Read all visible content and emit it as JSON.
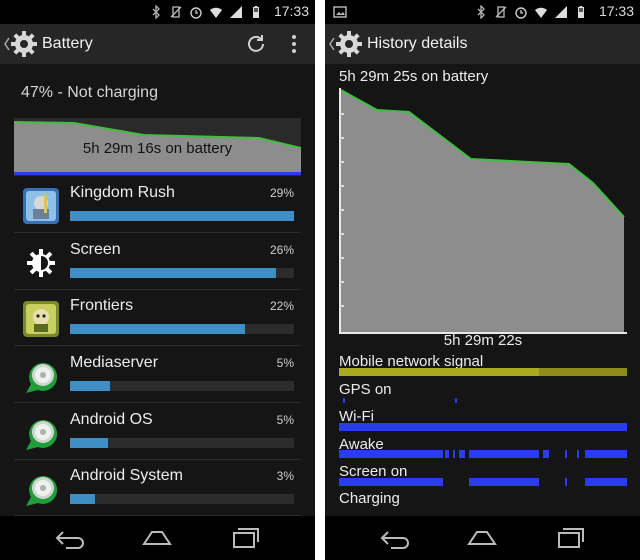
{
  "colors": {
    "graph_line": "#3fbf3f",
    "graph_fill": "#8d8d8d",
    "bar_blue": "#3d8fc6",
    "signal_yellow": "#a9ab1f",
    "signal_blue": "#2a3cf0"
  },
  "status_bar": {
    "time": "17:33",
    "icons": [
      "bluetooth-icon",
      "vibrate-off-icon",
      "alarm-icon",
      "wifi-icon",
      "cell-signal-icon",
      "battery-icon"
    ]
  },
  "left": {
    "title": "Battery",
    "charge_status": "47% - Not charging",
    "graph_caption": "5h 29m 16s on battery",
    "apps": [
      {
        "name": "Kingdom Rush",
        "percent": "29%",
        "fill": 1.0,
        "icon": "kingdom-rush-icon"
      },
      {
        "name": "Screen",
        "percent": "26%",
        "fill": 0.92,
        "icon": "brightness-icon"
      },
      {
        "name": "Frontiers",
        "percent": "22%",
        "fill": 0.78,
        "icon": "frontiers-icon"
      },
      {
        "name": "Mediaserver",
        "percent": "5%",
        "fill": 0.18,
        "icon": "android-system-icon"
      },
      {
        "name": "Android OS",
        "percent": "5%",
        "fill": 0.17,
        "icon": "android-system-icon"
      },
      {
        "name": "Android System",
        "percent": "3%",
        "fill": 0.11,
        "icon": "android-system-icon"
      }
    ]
  },
  "right": {
    "title": "History details",
    "top_caption": "5h 29m 25s on battery",
    "bottom_caption": "5h 29m 22s",
    "signals": [
      "Mobile network signal",
      "GPS on",
      "Wi-Fi",
      "Awake",
      "Screen on",
      "Charging"
    ]
  }
}
